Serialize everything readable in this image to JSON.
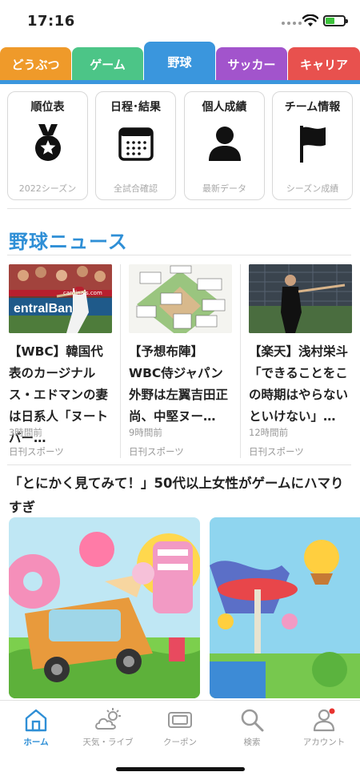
{
  "status_bar": {
    "time": "17:16",
    "battery_level": 0.45
  },
  "tabs": [
    {
      "label": "どうぶつ",
      "color": "#ef9a2a"
    },
    {
      "label": "ゲーム",
      "color": "#4cc587"
    },
    {
      "label": "野球",
      "color": "#3a96dd",
      "active": true
    },
    {
      "label": "サッカー",
      "color": "#a254cc"
    },
    {
      "label": "キャリア",
      "color": "#e8514e"
    }
  ],
  "menu": [
    {
      "title": "順位表",
      "sub": "2022シーズン",
      "icon": "medal-icon"
    },
    {
      "title": "日程･結果",
      "sub": "全試合確認",
      "icon": "calendar-icon"
    },
    {
      "title": "個人成績",
      "sub": "最新データ",
      "icon": "person-icon"
    },
    {
      "title": "チーム情報",
      "sub": "シーズン成績",
      "icon": "flag-icon"
    }
  ],
  "news": {
    "section_title": "野球ニュース",
    "items": [
      {
        "headline": "【WBC】韓国代表のカージナルス・エドマンの妻は日系人「ヌートバー…",
        "time": "3時間前",
        "source": "日刊スポーツ",
        "thumb_text": "cardinals.com"
      },
      {
        "headline": "【予想布陣】WBC侍ジャパン外野は左翼吉田正尚、中堅ヌー…",
        "time": "9時間前",
        "source": "日刊スポーツ"
      },
      {
        "headline": "【楽天】浅村栄斗「できることをこの時期はやらないといけない」…",
        "time": "12時間前",
        "source": "日刊スポーツ"
      }
    ]
  },
  "promo": {
    "text": "「とにかく見てみて！」50代以上女性がゲームにハマりすぎ"
  },
  "bottom_nav": [
    {
      "label": "ホーム",
      "icon": "home-icon",
      "active": true
    },
    {
      "label": "天気・ライブ",
      "icon": "weather-icon"
    },
    {
      "label": "クーポン",
      "icon": "coupon-icon"
    },
    {
      "label": "検索",
      "icon": "search-icon"
    },
    {
      "label": "アカウント",
      "icon": "account-icon",
      "badge": true
    }
  ]
}
